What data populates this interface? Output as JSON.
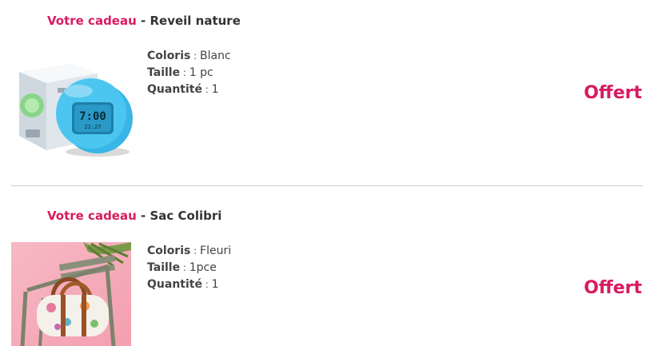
{
  "colors": {
    "accent": "#d81b60",
    "text": "#333333",
    "divider": "#cfcfcf"
  },
  "gifts": [
    {
      "prefix": "Votre cadeau",
      "separator": " - ",
      "name": "Reveil nature",
      "image_icon": "alarm-clock-product-photo",
      "attributes": [
        {
          "label": "Coloris",
          "colon": " : ",
          "value": "Blanc"
        },
        {
          "label": "Taille",
          "colon": " : ",
          "value": "1 pc"
        },
        {
          "label": "Quantité",
          "colon": " : ",
          "value": "1"
        }
      ],
      "price": "Offert"
    },
    {
      "prefix": "Votre cadeau",
      "separator": " - ",
      "name": "Sac Colibri",
      "image_icon": "bag-product-photo",
      "attributes": [
        {
          "label": "Coloris",
          "colon": " : ",
          "value": "Fleuri"
        },
        {
          "label": "Taille",
          "colon": " : ",
          "value": "1pce"
        },
        {
          "label": "Quantité",
          "colon": " : ",
          "value": "1"
        }
      ],
      "price": "Offert"
    }
  ]
}
